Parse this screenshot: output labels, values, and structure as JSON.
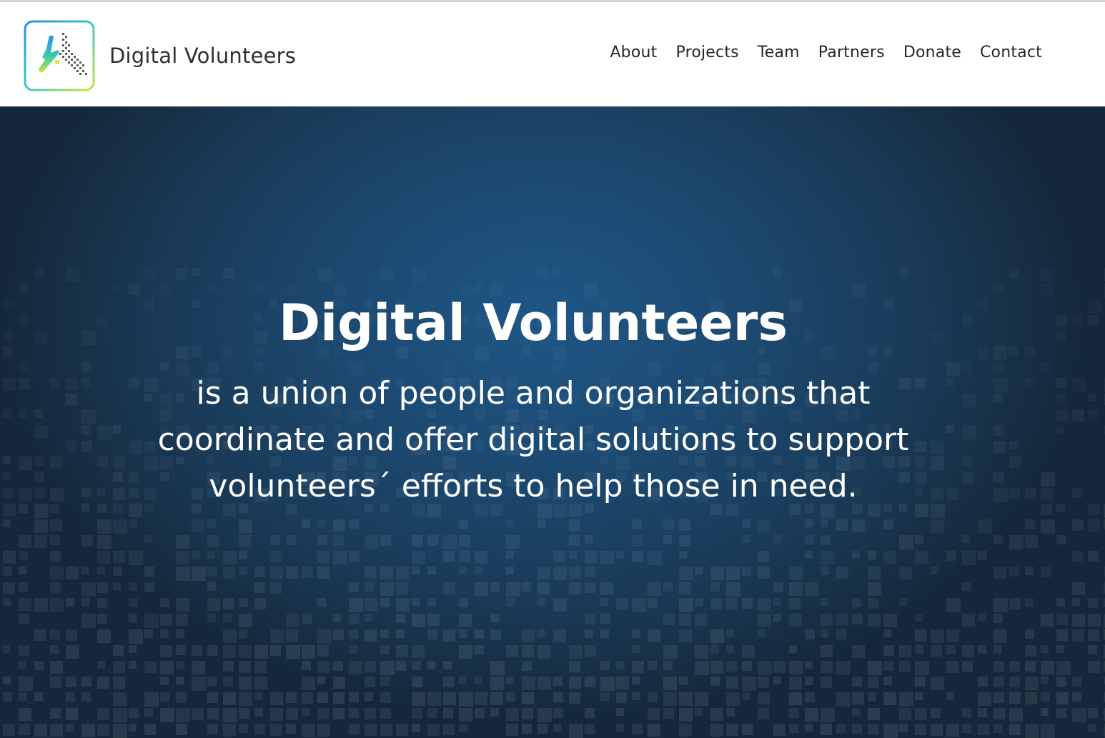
{
  "site": {
    "brand_name": "Digital Volunteers"
  },
  "nav": {
    "items": [
      {
        "label": "About"
      },
      {
        "label": "Projects"
      },
      {
        "label": "Team"
      },
      {
        "label": "Partners"
      },
      {
        "label": "Donate"
      },
      {
        "label": "Contact"
      }
    ]
  },
  "hero": {
    "title": "Digital Volunteers",
    "description": "is a union of people and organizations that coordinate and offer digital solutions to support volunteers´ efforts to help those in need."
  },
  "colors": {
    "header_bg": "#ffffff",
    "nav_text": "#262626",
    "hero_bg_center": "#1f5686",
    "hero_bg_edge": "#15283a",
    "hero_text": "#ffffff",
    "logo_gradient_start": "#2a8ee6",
    "logo_gradient_end": "#c8e63a"
  },
  "icons": {
    "logo": "hand-with-pixels-logo-icon"
  }
}
